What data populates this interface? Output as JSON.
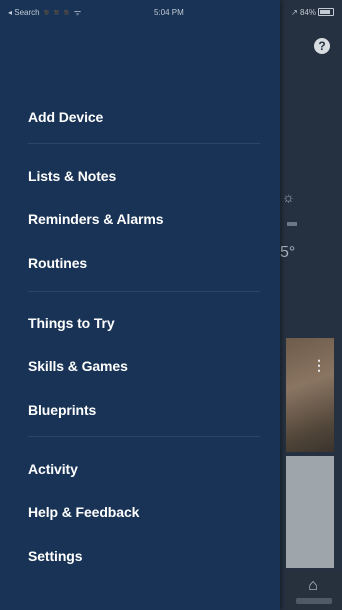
{
  "status_bar": {
    "left_text": "◂ Search ◾◾◾ ᯤ",
    "time": "5:04 PM",
    "right_text": "↗ 84%"
  },
  "background": {
    "help_icon": "help-icon",
    "help_symbol": "?",
    "weather_symbol": "☼",
    "temperature_text": "5°",
    "card_menu_symbol": "⋮",
    "nav_icon": "home-icon",
    "nav_symbol": "⌂"
  },
  "drawer": {
    "background_color": "#183355",
    "sections": [
      {
        "items": [
          {
            "label": "Add Device"
          }
        ]
      },
      {
        "items": [
          {
            "label": "Lists & Notes"
          },
          {
            "label": "Reminders & Alarms"
          },
          {
            "label": "Routines"
          }
        ]
      },
      {
        "items": [
          {
            "label": "Things to Try"
          },
          {
            "label": "Skills & Games"
          },
          {
            "label": "Blueprints"
          }
        ]
      },
      {
        "items": [
          {
            "label": "Activity"
          },
          {
            "label": "Help & Feedback"
          },
          {
            "label": "Settings"
          }
        ]
      }
    ]
  }
}
